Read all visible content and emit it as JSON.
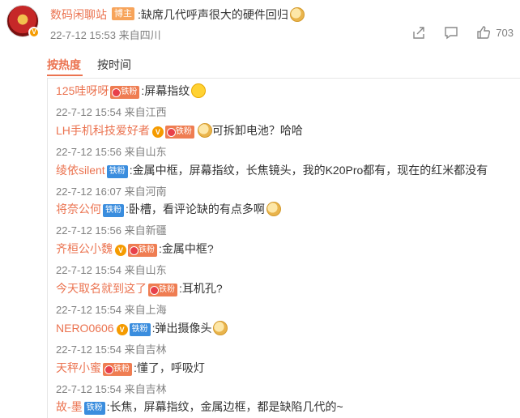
{
  "post": {
    "author": "数码闲聊站",
    "author_tag": "博主",
    "text": ":缺席几代呼声很大的硬件回归",
    "time": "22-7-12 15:53",
    "location": "来自四川",
    "like_count": "703"
  },
  "sort": {
    "hot": "按热度",
    "time": "按时间"
  },
  "comments": [
    {
      "name": "125哇呀呀",
      "badge": "铁粉",
      "badge_type": "iron",
      "text": ":屏幕指纹",
      "emoji": "smile",
      "time": "22-7-12 15:54",
      "location": "来自江西"
    },
    {
      "name": "LH手机科技爱好者",
      "verified": true,
      "badge": "铁粉",
      "badge_type": "iron",
      "text": "可拆卸电池？哈哈",
      "emoji_before": "doge",
      "time": "22-7-12 15:56",
      "location": "来自山东"
    },
    {
      "name": "绫依silent",
      "badge": "铁粉",
      "badge_type": "fan",
      "text": ":金属中框，屏幕指纹，长焦镜头，我的K20Pro都有，现在的红米都没有",
      "time": "22-7-12 16:07",
      "location": "来自河南"
    },
    {
      "name": "将奈公何",
      "badge": "铁粉",
      "badge_type": "fan",
      "text": ":卧槽，看评论缺的有点多啊",
      "emoji": "doge",
      "time": "22-7-12 15:56",
      "location": "来自新疆"
    },
    {
      "name": "齐桓公小魏",
      "verified": true,
      "badge": "铁粉",
      "badge_type": "iron",
      "text": ":金属中框?",
      "time": "22-7-12 15:54",
      "location": "来自山东"
    },
    {
      "name": "今天取名就到这了",
      "badge": "铁粉",
      "badge_type": "iron",
      "text": ":耳机孔?",
      "time": "22-7-12 15:54",
      "location": "来自上海"
    },
    {
      "name": "NERO0606",
      "verified": true,
      "badge": "铁粉",
      "badge_type": "fan",
      "text": ":弹出摄像头",
      "emoji": "doge",
      "time": "22-7-12 15:54",
      "location": "来自吉林"
    },
    {
      "name": "天秤小蜜",
      "badge": "铁粉",
      "badge_type": "iron",
      "text": ":懂了，呼吸灯",
      "time": "22-7-12 15:54",
      "location": "来自吉林"
    },
    {
      "name": "故-墨",
      "badge": "铁粉",
      "badge_type": "fan",
      "text": ":长焦，屏幕指纹，金属边框，都是缺陷几代的~"
    }
  ]
}
